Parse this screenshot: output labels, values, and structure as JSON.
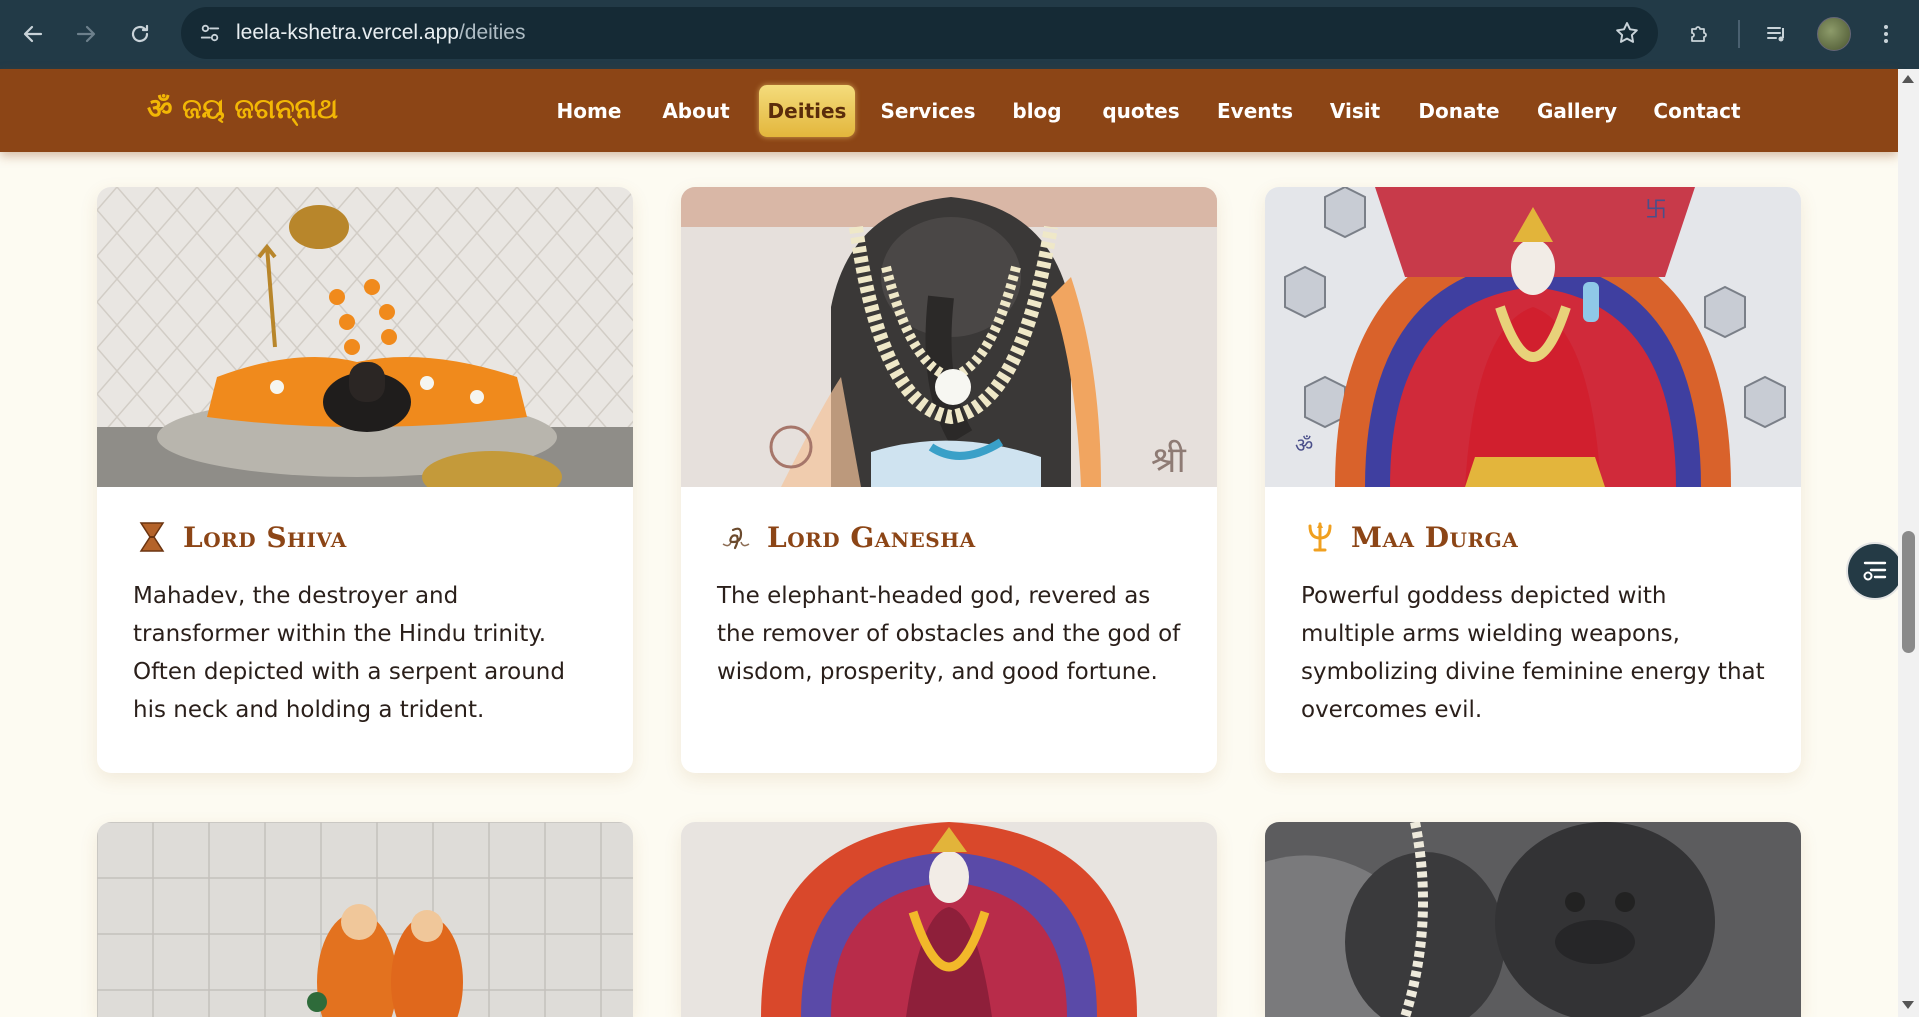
{
  "browser": {
    "url_host": "leela-kshetra.vercel.app",
    "url_path": "/deities"
  },
  "site": {
    "logo": "ॐ ଜୟ ଜଗନ୍ନାଥ",
    "nav": [
      {
        "label": "Home",
        "active": false
      },
      {
        "label": "About",
        "active": false
      },
      {
        "label": "Deities",
        "active": true
      },
      {
        "label": "Services",
        "active": false
      },
      {
        "label": "blog",
        "active": false
      },
      {
        "label": "quotes",
        "active": false
      },
      {
        "label": "Events",
        "active": false
      },
      {
        "label": "Visit",
        "active": false
      },
      {
        "label": "Donate",
        "active": false
      },
      {
        "label": "Gallery",
        "active": false
      },
      {
        "label": "Contact",
        "active": false
      }
    ]
  },
  "deities": [
    {
      "title": "Lord Shiva",
      "icon": "damaru-icon",
      "description": "Mahadev, the destroyer and transformer within the Hindu trinity. Often depicted with a serpent around his neck and holding a trident."
    },
    {
      "title": "Lord Ganesha",
      "icon": "ganesha-trunk-icon",
      "description": "The elephant-headed god, revered as the remover of obstacles and the god of wisdom, prosperity, and good fortune."
    },
    {
      "title": "Maa Durga",
      "icon": "trident-icon",
      "description": "Powerful goddess depicted with multiple arms wielding weapons, symbolizing divine feminine energy that overcomes evil."
    }
  ],
  "colors": {
    "header_bg": "#8c4516",
    "logo": "#f2b705",
    "title": "#8c4516",
    "active_nav": "#e3b63c",
    "page_bg": "#fdfbf2"
  }
}
